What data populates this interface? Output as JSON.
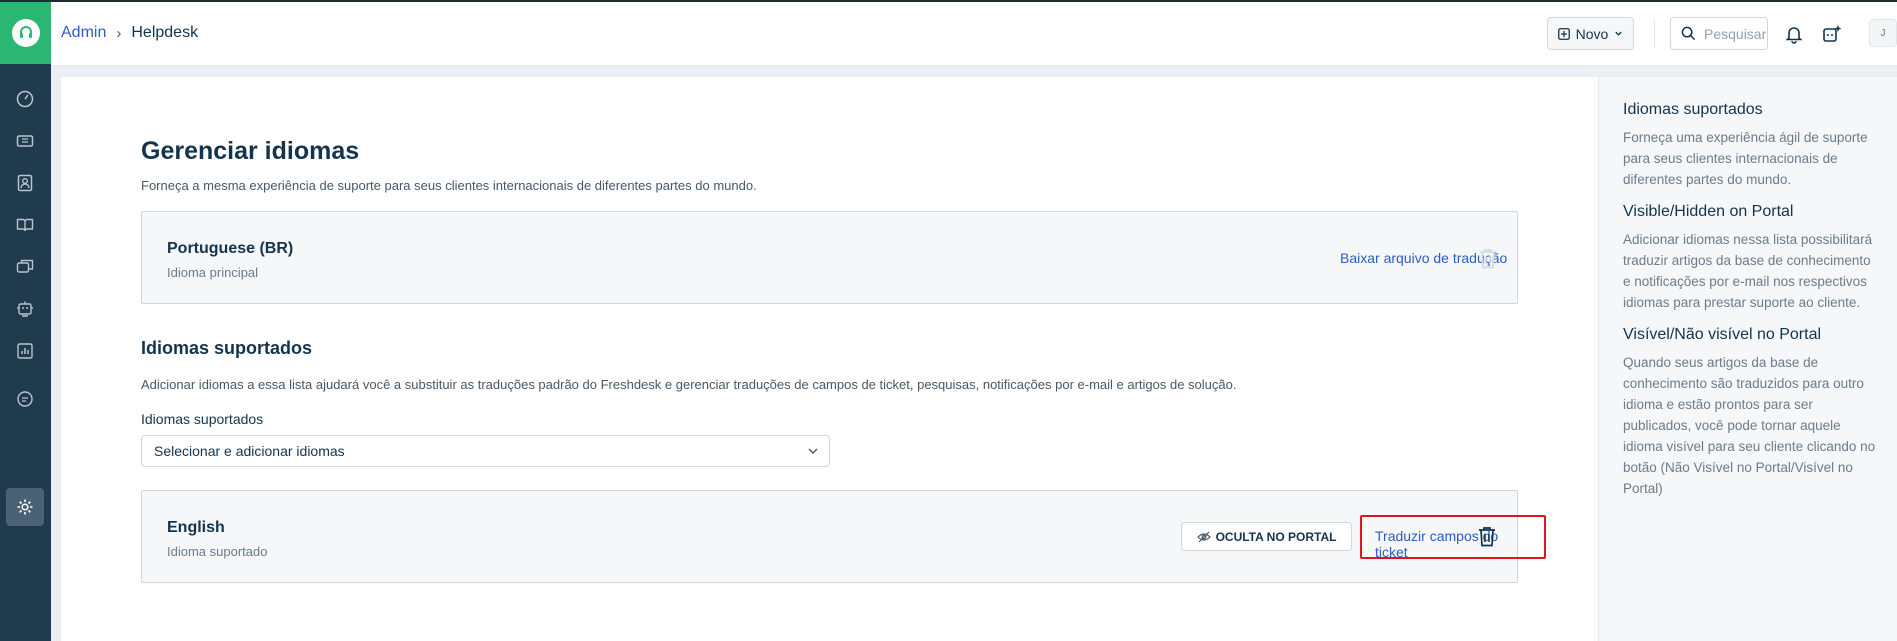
{
  "breadcrumb": {
    "parent": "Admin",
    "current": "Helpdesk"
  },
  "header": {
    "new_label": "Novo",
    "search_placeholder": "Pesquisar",
    "avatar_initial": "J"
  },
  "page": {
    "title": "Gerenciar idiomas",
    "subtitle": "Forneça a mesma experiência de suporte para seus clientes internacionais de diferentes partes do mundo."
  },
  "primary_language": {
    "name": "Portuguese (BR)",
    "role": "Idioma principal",
    "download_link": "Baixar arquivo de tradução"
  },
  "supported": {
    "title": "Idiomas suportados",
    "description": "Adicionar idiomas a essa lista ajudará você a substituir as traduções padrão do Freshdesk e gerenciar traduções de campos de ticket, pesquisas, notificações por e-mail e artigos de solução.",
    "field_label": "Idiomas suportados",
    "select_value": "Selecionar e adicionar idiomas",
    "languages": [
      {
        "name": "English",
        "role": "Idioma suportado",
        "visibility_label": "OCULTA NO PORTAL",
        "translate_link": "Traduzir campos do ticket"
      }
    ]
  },
  "help_panel": [
    {
      "title": "Idiomas suportados",
      "text": "Forneça uma experiência ágil de suporte para seus clientes internacionais de diferentes partes do mundo."
    },
    {
      "title": "Visible/Hidden on Portal",
      "text": "Adicionar idiomas nessa lista possibilitará traduzir artigos da base de conhecimento e notificações por e-mail nos respectivos idiomas para prestar suporte ao cliente."
    },
    {
      "title": "Visível/Não visível no Portal",
      "text": "Quando seus artigos da base de conhecimento são traduzidos para outro idioma e estão prontos para ser publicados, você pode tornar aquele idioma visível para seu cliente clicando no botão (Não Visível no Portal/Visível no Portal)"
    }
  ],
  "colors": {
    "brand_green": "#2bb673",
    "sidebar": "#1f3b4d",
    "link_blue": "#2c5cc5",
    "highlight_red": "#e0141c"
  },
  "sidebar_icons": [
    "dashboard-icon",
    "tickets-icon",
    "contacts-icon",
    "knowledge-base-icon",
    "forums-icon",
    "bot-icon",
    "reports-icon",
    "chat-icon",
    "admin-gear-icon"
  ]
}
